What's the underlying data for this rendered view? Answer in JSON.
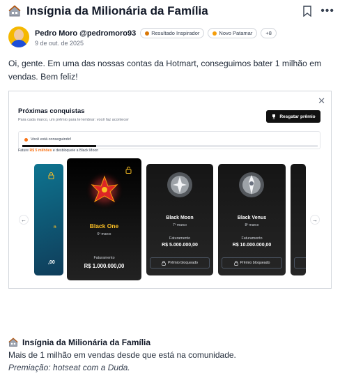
{
  "post": {
    "title": "Insígnia da Milionária da Família",
    "author": "Pedro Moro @pedromoro93",
    "badges": [
      "Resultado Inspirador",
      "Novo Patamar",
      "+8"
    ],
    "date": "9 de out. de 2025",
    "body": "Oi, gente. Em uma das nossas contas da Hotmart, conseguimos bater 1 milhão em vendas. Bem feliz!"
  },
  "embed": {
    "title": "Próximas conquistas",
    "subtitle": "Para cada marco, um prêmio para te lembrar: você faz acontecer",
    "redeem_label": "Resgatar prêmio",
    "progress_label": "Você está conseguindo!",
    "progress_fraction": 0.25,
    "hint_pre": "Fature",
    "hint_accent": "R$ 5 milhões",
    "hint_post": "e desbloqueie a Black Moon",
    "partial_card": {
      "name_fragment": "n",
      "value_fragment": ",00"
    },
    "cards": [
      {
        "name": "Black One",
        "date": "6º marco",
        "fat_label": "Faturamento",
        "value": "R$ 1.000.000,00"
      },
      {
        "name": "Black Moon",
        "date": "7º marco",
        "fat_label": "Faturamento",
        "value": "R$ 5.000.000,00",
        "button": "Prêmio bloqueado"
      },
      {
        "name": "Black Venus",
        "date": "8º marco",
        "fat_label": "Faturamento",
        "value": "R$ 10.000.000,00",
        "button": "Prêmio bloqueado"
      }
    ]
  },
  "footer": {
    "title": "Insígnia da Milionária da Família",
    "description": "Mais de 1 milhão em vendas desde que está na comunidade.",
    "prize": "Premiação: hotseat com a Duda."
  },
  "colors": {
    "accent": "#f97316",
    "gold": "#fbbf24",
    "dark": "#111111",
    "teal": "#0e7490"
  }
}
